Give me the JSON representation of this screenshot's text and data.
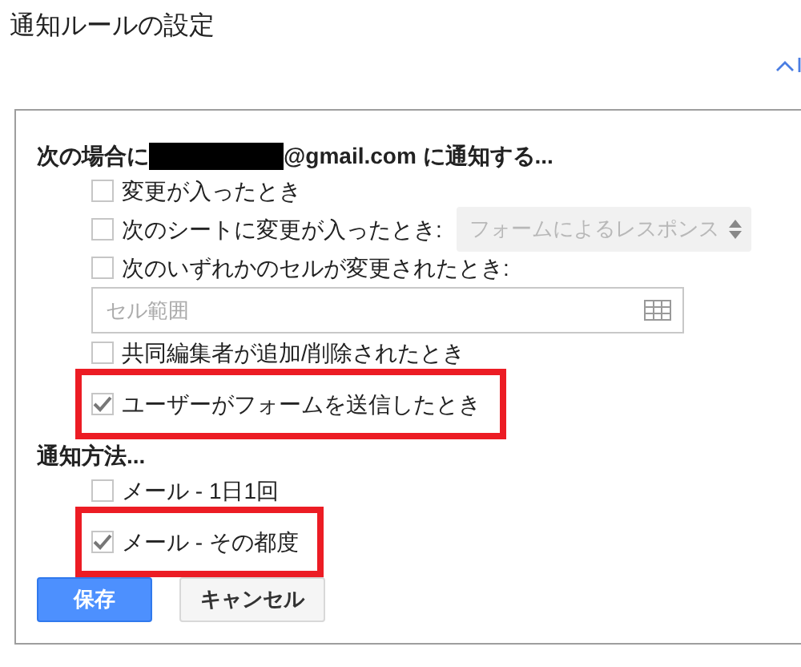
{
  "title": "通知ルールの設定",
  "conditions": {
    "heading_before": "次の場合に",
    "heading_after": "@gmail.com に通知する...",
    "items": [
      {
        "kind": "checkbox",
        "label": "変更が入ったとき",
        "checked": false,
        "highlighted": false
      },
      {
        "kind": "checkbox",
        "label": "次のシートに変更が入ったとき:",
        "checked": false,
        "highlighted": false,
        "select": {
          "value": "フォームによるレスポンス",
          "disabled": true
        }
      },
      {
        "kind": "checkbox",
        "label": "次のいずれかのセルが変更されたとき:",
        "checked": false,
        "highlighted": false
      },
      {
        "kind": "field",
        "placeholder": "セル範囲"
      },
      {
        "kind": "checkbox",
        "label": "共同編集者が追加/削除されたとき",
        "checked": false,
        "highlighted": false
      },
      {
        "kind": "checkbox",
        "label": "ユーザーがフォームを送信したとき",
        "checked": true,
        "highlighted": true
      }
    ]
  },
  "method": {
    "heading": "通知方法...",
    "items": [
      {
        "kind": "checkbox",
        "label": "メール - 1日1回",
        "checked": false,
        "highlighted": false
      },
      {
        "kind": "checkbox",
        "label": "メール - その都度",
        "checked": true,
        "highlighted": true
      }
    ]
  },
  "buttons": [
    {
      "label": "保存",
      "kind": "primary"
    },
    {
      "label": "キャンセル",
      "kind": "secondary"
    }
  ]
}
